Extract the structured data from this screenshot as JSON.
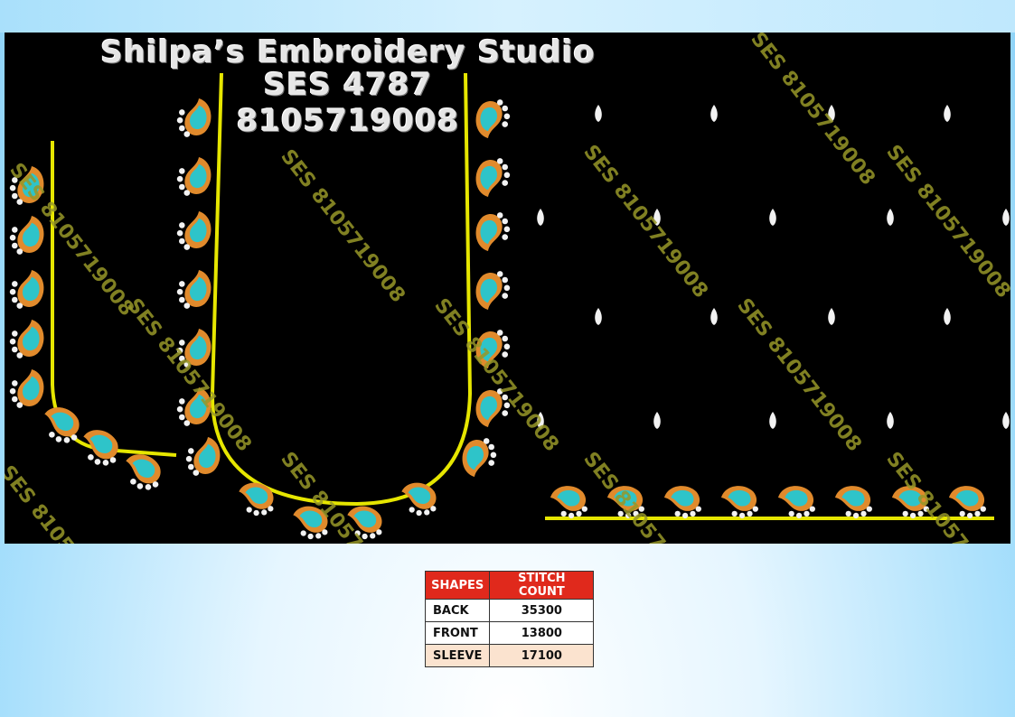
{
  "studio": {
    "name": "Shilpa’s Embroidery Studio",
    "design_code": "SES 4787",
    "phone": "8105719008"
  },
  "watermark_text": "SES 8105719008",
  "colors": {
    "thread_gold": "#e08a2c",
    "thread_cyan": "#2ec4c9",
    "thread_white": "#f2f2f2",
    "outline_yellow": "#e6e600",
    "table_header": "#e0291c"
  },
  "table": {
    "headers": [
      "SHAPES",
      "STITCH COUNT"
    ],
    "rows": [
      {
        "shape": "BACK",
        "count": "35300"
      },
      {
        "shape": "FRONT",
        "count": "13800"
      },
      {
        "shape": "SLEEVE",
        "count": "17100"
      }
    ]
  }
}
